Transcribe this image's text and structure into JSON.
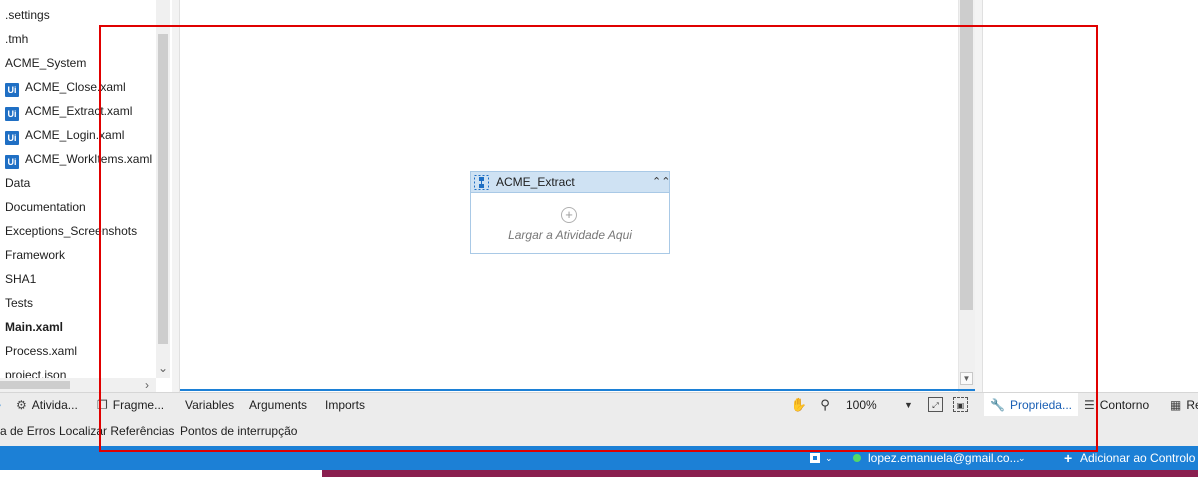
{
  "project_tree": {
    "items": [
      {
        "label": ".settings",
        "kind": "folder"
      },
      {
        "label": ".tmh",
        "kind": "folder"
      },
      {
        "label": "ACME_System",
        "kind": "folder"
      },
      {
        "label": "ACME_Close.xaml",
        "kind": "file",
        "icon": "Ui"
      },
      {
        "label": "ACME_Extract.xaml",
        "kind": "file",
        "icon": "Ui"
      },
      {
        "label": "ACME_Login.xaml",
        "kind": "file",
        "icon": "Ui"
      },
      {
        "label": "ACME_WorkItems.xaml",
        "kind": "file",
        "icon": "Ui"
      },
      {
        "label": "Data",
        "kind": "folder"
      },
      {
        "label": "Documentation",
        "kind": "folder"
      },
      {
        "label": "Exceptions_Screenshots",
        "kind": "folder"
      },
      {
        "label": "Framework",
        "kind": "folder"
      },
      {
        "label": "SHA1",
        "kind": "folder"
      },
      {
        "label": "Tests",
        "kind": "folder"
      },
      {
        "label": "Main.xaml",
        "kind": "file-bold"
      },
      {
        "label": "Process.xaml",
        "kind": "file"
      },
      {
        "label": "project.json",
        "kind": "file"
      }
    ]
  },
  "designer": {
    "sequence": {
      "title": "ACME_Extract",
      "drop_hint": "Largar a Atividade Aqui"
    }
  },
  "bottom_tabs": {
    "left": [
      {
        "label": "Ativida...",
        "icon": "activities-icon"
      },
      {
        "label": "Fragme...",
        "icon": "snippets-icon"
      }
    ],
    "designer": [
      {
        "label": "Variables"
      },
      {
        "label": "Arguments"
      },
      {
        "label": "Imports"
      }
    ],
    "zoom": "100%",
    "right": [
      {
        "label": "Proprieda...",
        "icon": "wrench-icon"
      },
      {
        "label": "Contorno",
        "icon": "outline-icon"
      },
      {
        "label": "Re",
        "icon": "resources-icon"
      }
    ]
  },
  "output_tabs": [
    {
      "label": "a de Erros"
    },
    {
      "label": "Localizar Referências"
    },
    {
      "label": "Pontos de interrupção"
    }
  ],
  "status_bar": {
    "account": "lopez.emanuela@gmail.co...",
    "add_to_control": "Adicionar ao Controlo"
  },
  "colors": {
    "accent": "#1c80d6",
    "sequence_header": "#cfe2f3",
    "highlight": "#e00000",
    "ui_badge": "#1f6fc4"
  }
}
